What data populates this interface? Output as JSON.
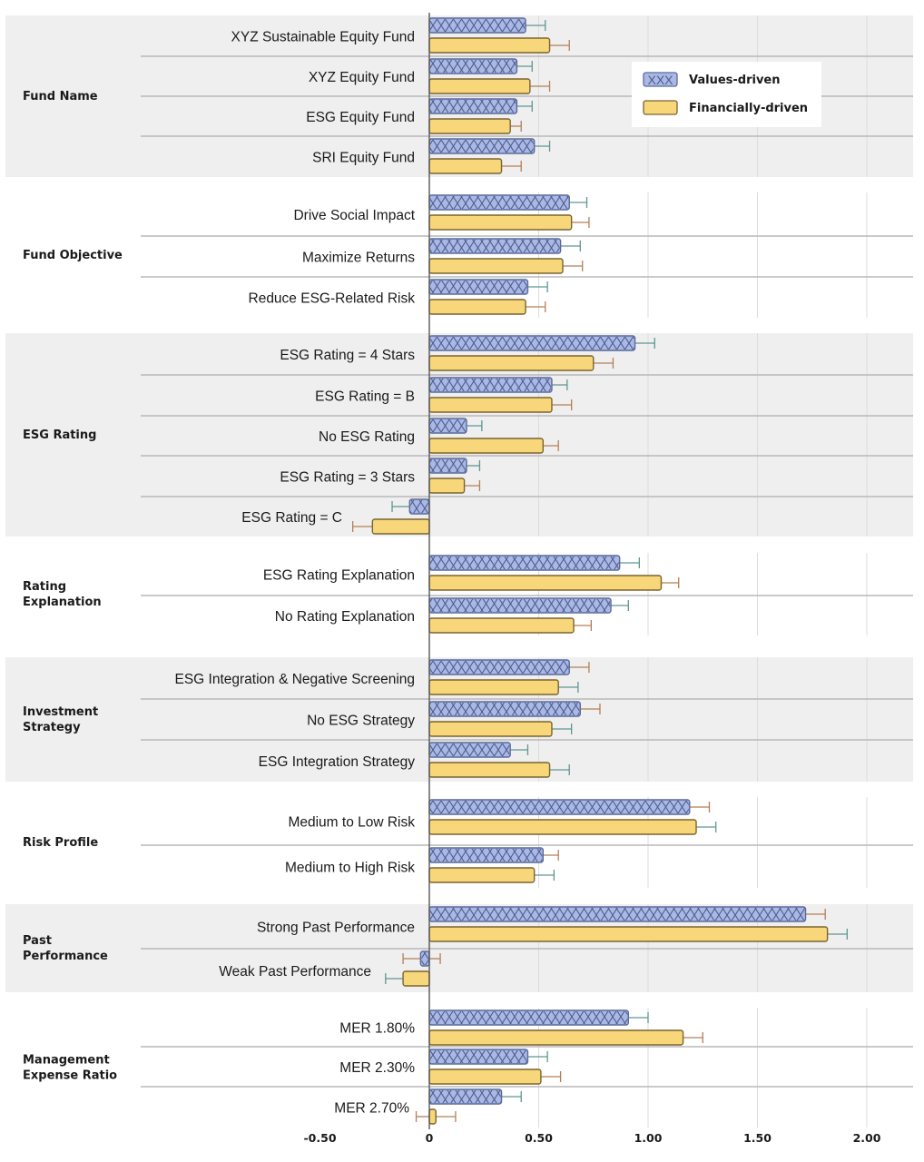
{
  "chart_data": {
    "type": "bar",
    "orientation": "horizontal",
    "title": "",
    "xlabel": "",
    "ylabel": "",
    "xlim": [
      -0.5,
      2.2
    ],
    "x_ticks": [
      -0.5,
      0,
      0.5,
      1.0,
      1.5,
      2.0
    ],
    "x_tick_labels": [
      "-0.50",
      "0",
      "0.50",
      "1.00",
      "1.50",
      "2.00"
    ],
    "grid": true,
    "legend": {
      "placement": "top-right",
      "entries": [
        {
          "name": "Values-driven",
          "swatch_text": "XXX",
          "color": "#aab8e6",
          "border": "#5a6a99",
          "pattern": "crosshatch-x"
        },
        {
          "name": "Financially-driven",
          "swatch_text": "",
          "color": "#f7d77a",
          "border": "#7a6430",
          "pattern": "solid"
        }
      ]
    },
    "series_colors": {
      "values_fill": "#aab8e6",
      "values_border": "#5a6a99",
      "values_hatch": "#4e5d8c",
      "financial_fill": "#f7d77a",
      "financial_border": "#7a6430",
      "err_teal": "#5f9690",
      "err_brown": "#b57f56",
      "band_bg": "#efefef",
      "separator": "#b9b9b9",
      "gridline": "#dcdcdc",
      "axis": "#555555"
    },
    "groups": [
      {
        "name": "Fund Name",
        "shaded": true,
        "rows": [
          {
            "label": "XYZ Sustainable Equity Fund",
            "values_driven": 0.44,
            "values_err_end": 0.53,
            "financially_driven": 0.55,
            "financial_err_end": 0.64
          },
          {
            "label": "XYZ Equity Fund",
            "values_driven": 0.4,
            "values_err_end": 0.47,
            "financially_driven": 0.46,
            "financial_err_end": 0.55
          },
          {
            "label": "ESG Equity Fund",
            "values_driven": 0.4,
            "values_err_end": 0.47,
            "financially_driven": 0.37,
            "financial_err_end": 0.42
          },
          {
            "label": "SRI Equity Fund",
            "values_driven": 0.48,
            "values_err_end": 0.55,
            "financially_driven": 0.33,
            "financial_err_end": 0.42
          }
        ]
      },
      {
        "name": "Fund Objective",
        "shaded": false,
        "rows": [
          {
            "label": "Drive Social Impact",
            "values_driven": 0.64,
            "values_err_end": 0.72,
            "financially_driven": 0.65,
            "financial_err_end": 0.73
          },
          {
            "label": "Maximize Returns",
            "values_driven": 0.6,
            "values_err_end": 0.69,
            "financially_driven": 0.61,
            "financial_err_end": 0.7
          },
          {
            "label": "Reduce ESG-Related Risk",
            "values_driven": 0.45,
            "values_err_end": 0.54,
            "financially_driven": 0.44,
            "financial_err_end": 0.53
          }
        ]
      },
      {
        "name": "ESG Rating",
        "shaded": true,
        "rows": [
          {
            "label": "ESG Rating = 4 Stars",
            "values_driven": 0.94,
            "values_err_end": 1.03,
            "financially_driven": 0.75,
            "financial_err_end": 0.84
          },
          {
            "label": "ESG Rating = B",
            "values_driven": 0.56,
            "values_err_end": 0.63,
            "financially_driven": 0.56,
            "financial_err_end": 0.65
          },
          {
            "label": "No ESG Rating",
            "values_driven": 0.17,
            "values_err_end": 0.24,
            "financially_driven": 0.52,
            "financial_err_end": 0.59
          },
          {
            "label": "ESG Rating = 3 Stars",
            "values_driven": 0.17,
            "values_err_end": 0.23,
            "financially_driven": 0.16,
            "financial_err_end": 0.23
          },
          {
            "label": "ESG Rating = C",
            "values_driven": -0.09,
            "values_err_end": -0.17,
            "financially_driven": -0.26,
            "financial_err_end": -0.35
          }
        ]
      },
      {
        "name": "Rating Explanation",
        "label_lines": [
          "Rating",
          "Explanation"
        ],
        "shaded": false,
        "rows": [
          {
            "label": "ESG Rating Explanation",
            "values_driven": 0.87,
            "values_err_end": 0.96,
            "financially_driven": 1.06,
            "financial_err_end": 1.14
          },
          {
            "label": "No Rating Explanation",
            "values_driven": 0.83,
            "values_err_end": 0.91,
            "financially_driven": 0.66,
            "financial_err_end": 0.74
          }
        ]
      },
      {
        "name": "Investment Strategy",
        "label_lines": [
          "Investment",
          "Strategy"
        ],
        "shaded": true,
        "rows": [
          {
            "label": "ESG Integration & Negative Screening",
            "values_driven": 0.64,
            "values_err_end": 0.73,
            "financially_driven": 0.59,
            "financial_err_end": 0.68
          },
          {
            "label": "No ESG Strategy",
            "values_driven": 0.69,
            "values_err_end": 0.78,
            "financially_driven": 0.56,
            "financial_err_end": 0.65
          },
          {
            "label": "ESG Integration Strategy",
            "values_driven": 0.37,
            "values_err_end": 0.45,
            "financially_driven": 0.55,
            "financial_err_end": 0.64
          }
        ]
      },
      {
        "name": "Risk Profile",
        "shaded": false,
        "rows": [
          {
            "label": "Medium to Low Risk",
            "values_driven": 1.19,
            "values_err_end": 1.28,
            "financially_driven": 1.22,
            "financial_err_end": 1.31
          },
          {
            "label": "Medium to High Risk",
            "values_driven": 0.52,
            "values_err_end": 0.59,
            "financially_driven": 0.48,
            "financial_err_end": 0.57
          }
        ]
      },
      {
        "name": "Past Performance",
        "label_lines": [
          "Past",
          "Performance"
        ],
        "shaded": true,
        "rows": [
          {
            "label": "Strong Past Performance",
            "values_driven": 1.72,
            "values_err_end": 1.81,
            "financially_driven": 1.82,
            "financial_err_end": 1.91
          },
          {
            "label": "Weak Past Performance",
            "values_driven": -0.04,
            "values_err_end": -0.12,
            "values_err_end2": 0.05,
            "financially_driven": -0.12,
            "financial_err_end": -0.2
          }
        ]
      },
      {
        "name": "Management Expense Ratio",
        "label_lines": [
          "Management",
          "Expense Ratio"
        ],
        "shaded": false,
        "rows": [
          {
            "label": "MER 1.80%",
            "values_driven": 0.91,
            "values_err_end": 1.0,
            "financially_driven": 1.16,
            "financial_err_end": 1.25
          },
          {
            "label": "MER 2.30%",
            "values_driven": 0.45,
            "values_err_end": 0.54,
            "financially_driven": 0.51,
            "financial_err_end": 0.6
          },
          {
            "label": "MER 2.70%",
            "values_driven": 0.33,
            "values_err_end": 0.42,
            "financially_driven": 0.03,
            "financial_err_end": 0.12,
            "financial_err_end2": -0.06
          }
        ]
      }
    ]
  }
}
